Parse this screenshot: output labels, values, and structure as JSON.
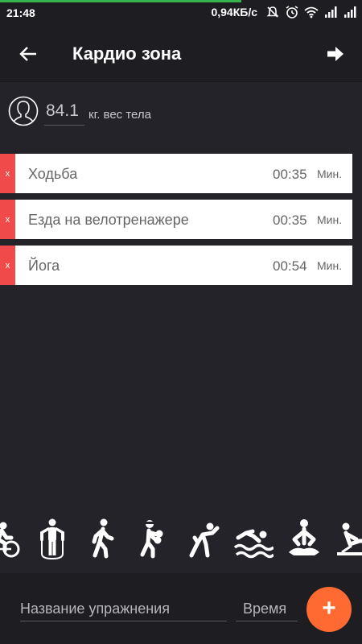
{
  "status_bar": {
    "time": "21:48",
    "speed": "0,94КБ/с",
    "icons": [
      "mute-icon",
      "alarm-icon",
      "wifi-icon",
      "signal-icon",
      "signal-icon"
    ]
  },
  "app_bar": {
    "title": "Кардио зона",
    "back_icon": "arrow-left-icon",
    "forward_icon": "arrow-right-icon"
  },
  "weight": {
    "value": "84.1",
    "label": "кг. вес тела",
    "icon": "person-icon"
  },
  "exercises": [
    {
      "delete_label": "x",
      "name": "Ходьба",
      "time": "00:35",
      "unit": "Мин."
    },
    {
      "delete_label": "x",
      "name": "Езда на велотренажере",
      "time": "00:35",
      "unit": "Мин."
    },
    {
      "delete_label": "x",
      "name": "Йога",
      "time": "00:54",
      "unit": "Мин."
    }
  ],
  "activity_icons": [
    "cycling-icon",
    "jump-rope-icon",
    "walking-icon",
    "boxing-icon",
    "stretching-icon",
    "swimming-icon",
    "yoga-icon",
    "rowing-icon"
  ],
  "bottom": {
    "name_placeholder": "Название упражнения",
    "time_placeholder": "Время",
    "add_label": "+"
  },
  "colors": {
    "background": "#24232a",
    "bar": "#1e1d22",
    "delete": "#f04a4a",
    "accent": "#ff6a32",
    "progress": "#37b24d"
  }
}
